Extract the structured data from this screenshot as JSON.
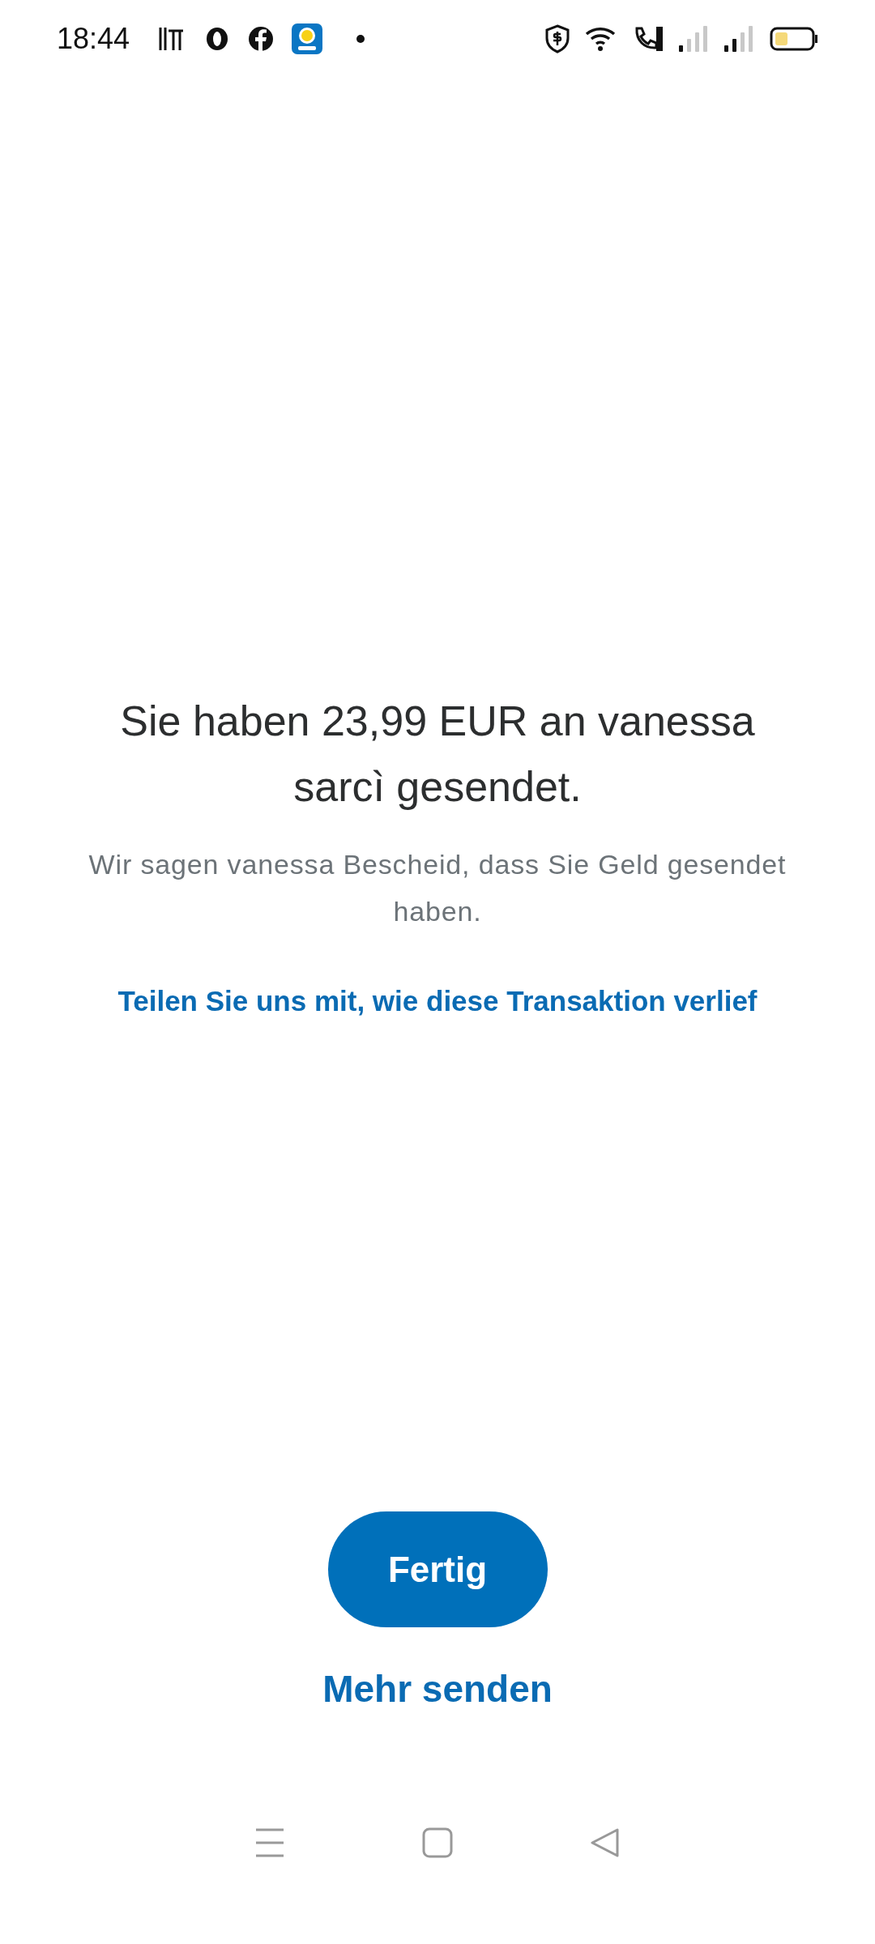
{
  "status_bar": {
    "time": "18:44"
  },
  "confirmation": {
    "title": "Sie haben 23,99 EUR an vanessa sarcì gesendet.",
    "message": "Wir sagen vanessa Bescheid, dass Sie Geld gesendet haben.",
    "feedback_link": "Teilen Sie uns mit, wie diese Transaktion verlief"
  },
  "buttons": {
    "primary": "Fertig",
    "secondary": "Mehr senden"
  }
}
